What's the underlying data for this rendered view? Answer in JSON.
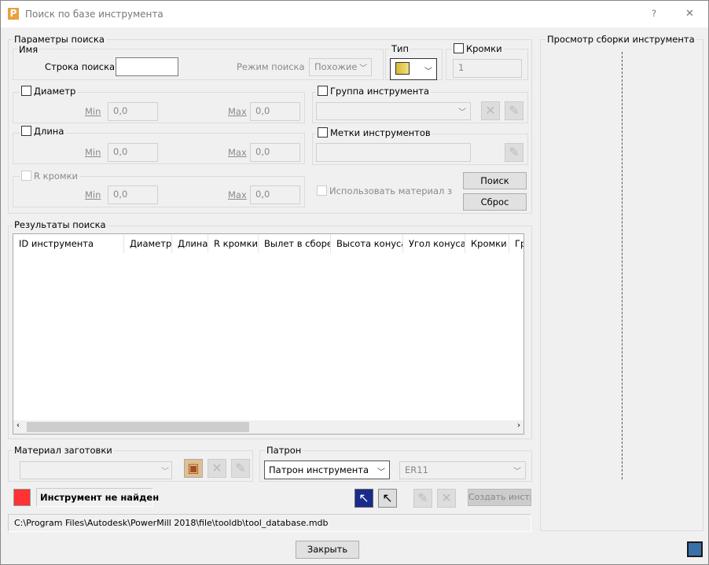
{
  "window": {
    "title": "Поиск по базе инструмента",
    "help": "?",
    "close": "✕"
  },
  "params": {
    "legend": "Параметры поиска",
    "name": {
      "legend": "Имя",
      "search_label": "Строка поиска",
      "search_value": "",
      "mode_label": "Режим поиска",
      "mode_value": "Похожие"
    },
    "type": {
      "legend": "Тип"
    },
    "edges": {
      "label": "Кромки",
      "value": "1"
    },
    "diameter": {
      "label": "Диаметр",
      "min_label": "Min",
      "min": "0,0",
      "max_label": "Max",
      "max": "0,0"
    },
    "length": {
      "label": "Длина",
      "min_label": "Min",
      "min": "0,0",
      "max_label": "Max",
      "max": "0,0"
    },
    "radius": {
      "label": "R кромки",
      "min_label": "Min",
      "min": "0,0",
      "max_label": "Max",
      "max": "0,0"
    },
    "group": {
      "label": "Группа инструмента"
    },
    "tags": {
      "label": "Метки инструментов"
    },
    "use_material": "Использовать материал заго",
    "search_btn": "Поиск",
    "reset_btn": "Сброс"
  },
  "results": {
    "legend": "Результаты поиска",
    "columns": [
      "ID инструмента",
      "Диаметр",
      "Длина",
      "R кромки",
      "Вылет в сборе",
      "Высота конуса",
      "Угол конуса",
      "Кромки",
      "Гр"
    ]
  },
  "material": {
    "legend": "Материал заготовки",
    "value": ""
  },
  "holder": {
    "legend": "Патрон",
    "value": "Патрон инструмента",
    "second": "ER11"
  },
  "status": {
    "text": "Инструмент не найден",
    "color": "#ff3333",
    "create_btn": "Создать инстр"
  },
  "path": "C:\\Program Files\\Autodesk\\PowerMill 2018\\file\\tooldb\\tool_database.mdb",
  "preview": {
    "legend": "Просмотр сборки инструмента"
  },
  "close_btn": "Закрыть"
}
